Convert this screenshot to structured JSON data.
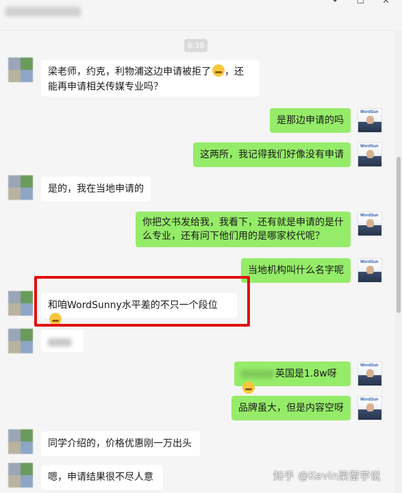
{
  "window": {
    "minimize_glyph": "⏷",
    "maximize_glyph": "☐",
    "close_glyph": "✕"
  },
  "timestamp": "8:38",
  "messages": [
    {
      "side": "left",
      "text_a": "梁老师，约克，利物浦这边申请被拒了",
      "text_b": "，还能再申请相关传媒专业吗？"
    },
    {
      "side": "right",
      "text": "是那边申请的吗"
    },
    {
      "side": "right",
      "text": "这两所，我记得我们好像没有申请"
    },
    {
      "side": "left",
      "text": "是的，我在当地申请的"
    },
    {
      "side": "right",
      "text": "你把文书发给我，我看下，还有就是申请的是什么专业，还有问下他们用的是哪家校代呢？"
    },
    {
      "side": "right",
      "text": "当地机构叫什么名字呢"
    },
    {
      "side": "left",
      "text": "和咱WordSunny水平差的不只一个段位"
    },
    {
      "side": "left",
      "text": ""
    },
    {
      "side": "right",
      "text": "英国是1.8w呀"
    },
    {
      "side": "right",
      "text": "品牌虽大，但是内容空呀"
    },
    {
      "side": "left",
      "text": "同学介绍的，价格优惠刚一万出头"
    },
    {
      "side": "left",
      "text": "嗯，申请结果很不尽人意"
    }
  ],
  "avatar_logo": "WordSun",
  "watermark": "知乎 @Kevin梁留学说",
  "colors": {
    "left_bubble": "#ffffff",
    "right_bubble": "#95ec69",
    "highlight": "#e10d0d"
  }
}
